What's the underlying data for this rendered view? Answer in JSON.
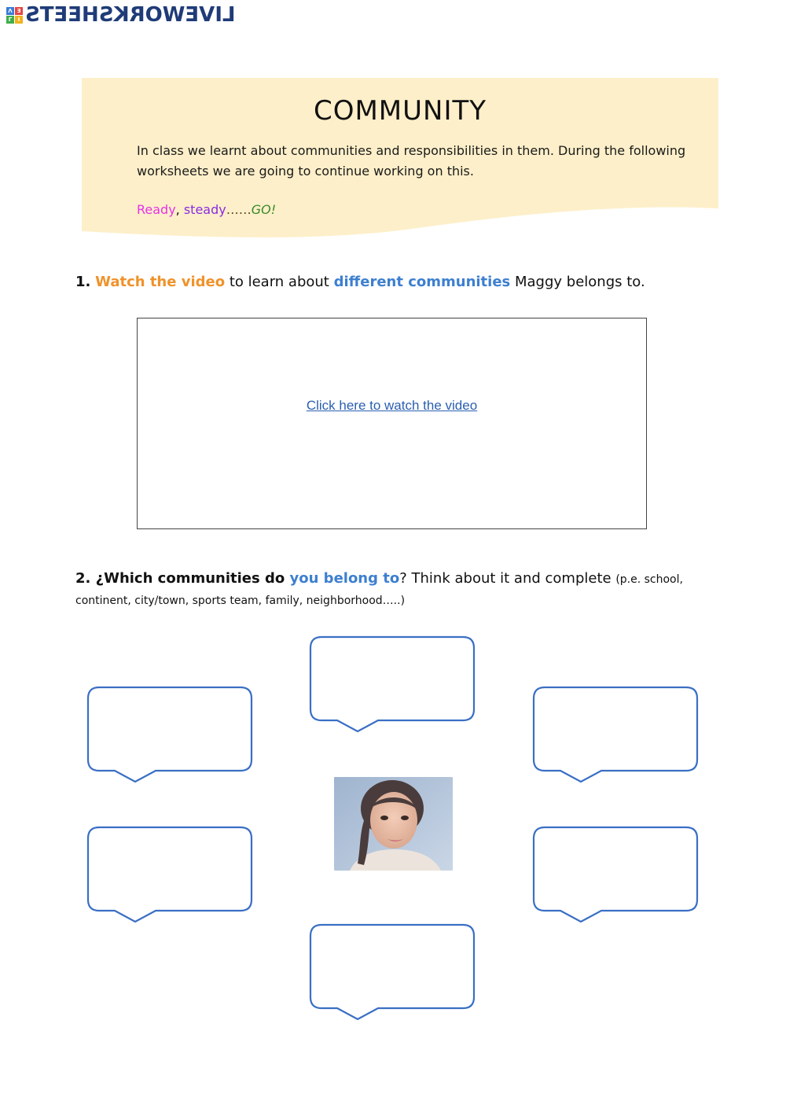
{
  "logo": {
    "text": "LIVEWORKSHEETS",
    "blocks": [
      "Λ",
      "Ǝ",
      "Γ",
      "I"
    ],
    "icon": "liveworksheets-logo-icon"
  },
  "banner": {
    "title": "COMMUNITY",
    "text": "In class we learnt about communities and responsibilities in them. During the following worksheets we are going to continue working on this.",
    "go": {
      "ready": "Ready",
      "comma": ", ",
      "steady": "steady",
      "dots": "……",
      "go": "GO!"
    },
    "background_color": "#fdefc9"
  },
  "question1": {
    "number": "1.",
    "highlight1": "Watch the video",
    "text1": " to learn about ",
    "highlight2": "different communities",
    "text2": " Maggy belongs to."
  },
  "video": {
    "link_label": "Click here to watch the video"
  },
  "question2": {
    "number": "2.",
    "bold_text": " ¿Which communities do ",
    "highlight": "you belong to",
    "text": "? Think about it and complete ",
    "hint": "(p.e. school, continent, city/town, sports team, family, neighborhood…..)"
  },
  "bubbles": [
    {
      "id": "top-center",
      "value": ""
    },
    {
      "id": "upper-left",
      "value": ""
    },
    {
      "id": "upper-right",
      "value": ""
    },
    {
      "id": "lower-left",
      "value": ""
    },
    {
      "id": "lower-right",
      "value": ""
    },
    {
      "id": "bottom-center",
      "value": ""
    }
  ],
  "photo": {
    "description": "girl-portrait-photo"
  },
  "colors": {
    "orange": "#f0922a",
    "blue": "#3d7fd0",
    "bubble_stroke": "#3a6fc4",
    "link": "#2b5fb0"
  }
}
